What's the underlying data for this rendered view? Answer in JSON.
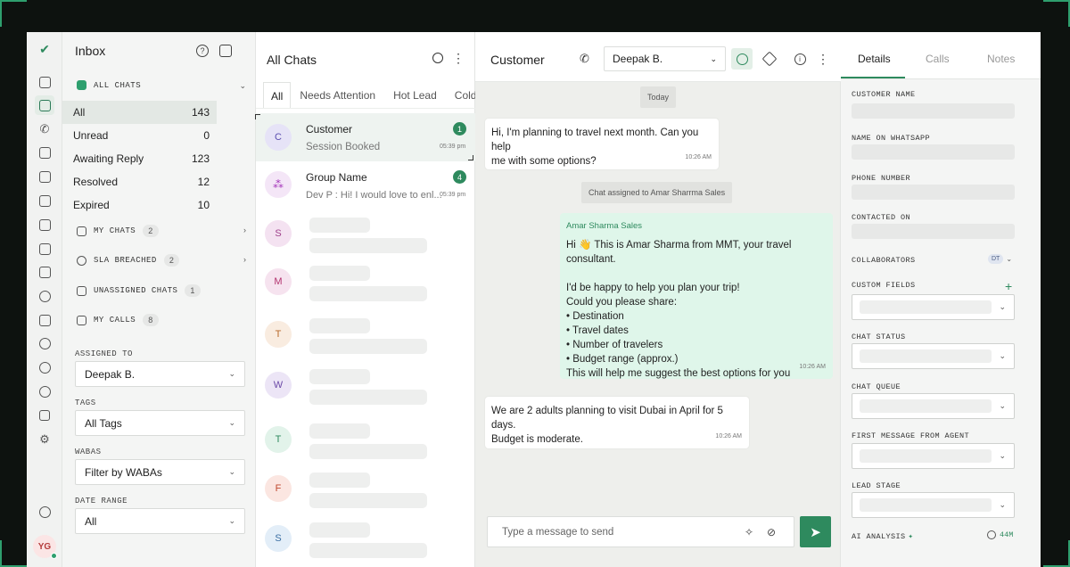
{
  "colors": {
    "accent": "#2e8a5e",
    "outgoing_bubble": "#dff6ea",
    "background": "#0d120f"
  },
  "rail": {
    "icons": [
      "checkmark-logo-icon",
      "home-icon",
      "chats-icon",
      "phone-icon",
      "megaphone-icon",
      "mail-icon",
      "calendar-icon",
      "contact-icon",
      "analytics-icon",
      "reports-icon",
      "speedometer-icon",
      "document-icon",
      "team-icon",
      "bot-icon",
      "settings-icon",
      "ads-icon",
      "gear-icon",
      "logout-icon"
    ],
    "avatar_initials": "YG"
  },
  "sidebar": {
    "title": "Inbox",
    "all_chats": {
      "label": "ALL CHATS"
    },
    "filters": [
      {
        "label": "All",
        "count": "143"
      },
      {
        "label": "Unread",
        "count": "0"
      },
      {
        "label": "Awaiting Reply",
        "count": "123"
      },
      {
        "label": "Resolved",
        "count": "12"
      },
      {
        "label": "Expired",
        "count": "10"
      }
    ],
    "sections": [
      {
        "label": "MY CHATS",
        "count": "2"
      },
      {
        "label": "SLA BREACHED",
        "count": "2"
      },
      {
        "label": "UNASSIGNED CHATS",
        "count": "1"
      },
      {
        "label": "MY CALLS",
        "count": "8"
      }
    ],
    "assigned_to": {
      "label": "ASSIGNED TO",
      "value": "Deepak B."
    },
    "tags": {
      "label": "TAGS",
      "value": "All Tags"
    },
    "wabas": {
      "label": "WABAS",
      "value": "Filter by WABAs"
    },
    "date_range": {
      "label": "DATE RANGE",
      "value": "All"
    }
  },
  "chatlist": {
    "title": "All Chats",
    "tabs": [
      "All",
      "Needs Attention",
      "Hot Lead",
      "Cold L"
    ],
    "chats": [
      {
        "initial": "C",
        "name": "Customer",
        "preview": "Session Booked",
        "time": "05:39 pm",
        "badge": "1"
      },
      {
        "initial": "",
        "name": "Group Name",
        "preview": "Dev P : Hi! I would love to enl...",
        "time": "05:39 pm",
        "badge": "4"
      }
    ],
    "placeholders": [
      "S",
      "M",
      "T",
      "W",
      "T",
      "F",
      "S"
    ]
  },
  "conversation": {
    "title": "Customer",
    "agent": "Deepak B.",
    "date_chip": "Today",
    "system_chip": "Chat assigned to Amar Sharrma Sales",
    "messages": [
      {
        "lines": [
          "Hi, I'm planning to travel next month. Can you help",
          "me with some options?"
        ],
        "time": "10:26 AM"
      },
      {
        "sender": "Amar Sharma Sales",
        "lines": [
          "Hi 👋 This is Amar Sharma from MMT, your travel consultant.",
          "",
          "I'd be happy to help you plan your trip!",
          "Could you please share:",
          "• Destination",
          "• Travel dates",
          "• Number of travelers",
          "• Budget range (approx.)",
          "This will help me suggest the best options for you"
        ],
        "time": "10:26 AM"
      },
      {
        "lines": [
          "We are 2 adults planning to visit Dubai in April for 5 days.",
          "Budget is moderate."
        ],
        "time": "10:26 AM"
      }
    ],
    "composer_placeholder": "Type a message to send"
  },
  "details": {
    "tabs": [
      "Details",
      "Calls",
      "Notes"
    ],
    "fields": [
      "CUSTOMER NAME",
      "NAME ON WHATSAPP",
      "PHONE NUMBER",
      "CONTACTED ON"
    ],
    "collaborators": {
      "label": "COLLABORATORS",
      "badge": "DT"
    },
    "custom_fields": "CUSTOM FIELDS",
    "selects": [
      "CHAT STATUS",
      "CHAT QUEUE",
      "FIRST MESSAGE FROM AGENT",
      "LEAD STAGE"
    ],
    "ai_analysis": {
      "label": "AI ANALYSIS",
      "time": "44M"
    }
  }
}
